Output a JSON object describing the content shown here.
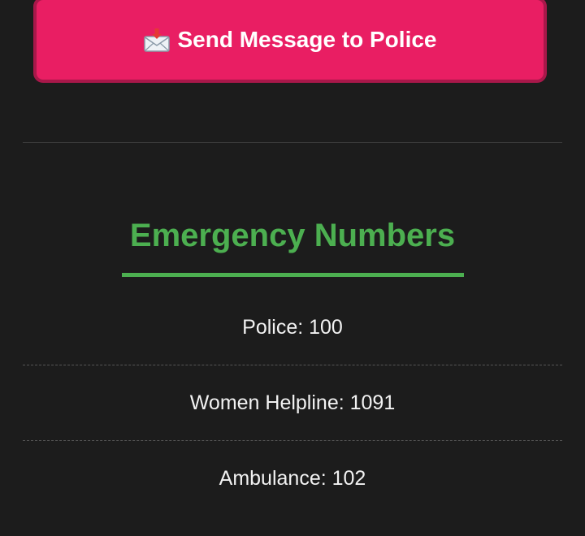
{
  "send_button": {
    "icon": "envelope-with-arrow-icon",
    "label": "Send Message to Police"
  },
  "emergency": {
    "title": "Emergency Numbers",
    "items": [
      {
        "text": "Police: 100"
      },
      {
        "text": "Women Helpline: 1091"
      },
      {
        "text": "Ambulance: 102"
      }
    ]
  },
  "colors": {
    "background": "#1c1c1c",
    "button": "#e91e63",
    "button_border": "#a8184a",
    "heading": "#4caf50",
    "text": "#f2f2f2"
  }
}
